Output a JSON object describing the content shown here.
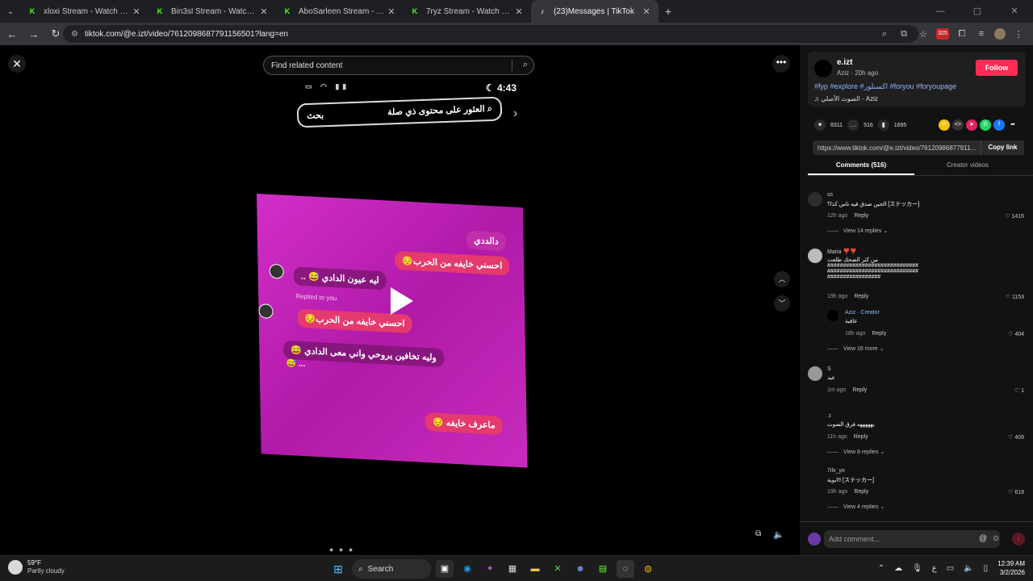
{
  "browser": {
    "tabs": [
      {
        "title": "xloxi Stream - Watch Live on Ki",
        "favicon": "kick-icon",
        "active": false
      },
      {
        "title": "Bin3sl Stream - Watch Live on K",
        "favicon": "kick-icon",
        "active": false
      },
      {
        "title": "AboSarleen Stream - Watch Liv",
        "favicon": "kick-icon",
        "active": false
      },
      {
        "title": "7ryz Stream - Watch Live on Ki",
        "favicon": "kick-icon",
        "active": false
      },
      {
        "title": "(23)Messages | TikTok",
        "favicon": "tiktok-icon",
        "active": true
      }
    ],
    "url": "tiktok.com/@e.izt/video/7612098687791156501?lang=en",
    "extension_badge": "325"
  },
  "video": {
    "find_placeholder": "Find related content",
    "status_time": "4:43",
    "ar_search_text": "العثور على محتوى ذي صلة",
    "ar_search_button": "بحث",
    "chat": {
      "name": "دالددي",
      "msg1": "احسني خايفه من الحرب😔",
      "msg2": "ليه عيون الدادي 😅 ..",
      "replied_label": "Replied to you",
      "msg3": "احسني خايفه من الحرب😔",
      "msg4": "وليه تخافين يروحي واني معى الدادي 😅",
      "msg4b": "... 😅",
      "msg5": "ماعرف خايفه 😔"
    }
  },
  "panel": {
    "username": "e.izt",
    "meta": "Aziz · 20h ago",
    "follow_label": "Follow",
    "tags": "#fyp #explore #اكسبلور #foryou #foryoupage",
    "sound": "♫ الصوت الأصلي - Aziz",
    "likes": "8311",
    "comments_count": "516",
    "saves": "1695",
    "link": "https://www.tiktok.com/@e.izt/video/76120986877911...",
    "copy_label": "Copy link",
    "tab_comments": "Comments (516)",
    "tab_creator": "Creator videos",
    "comments": [
      {
        "name": "ss",
        "text": "الحين صدق فيه ناس كذا؟ [ステッカー]",
        "time": "12h ago",
        "likes": "1416",
        "view_replies": "View 14 replies"
      },
      {
        "name": "Maria ❣️❣️",
        "text": "من كثر الضحك طلعت\n#############################\n#############################\n#################",
        "time": "19h ago",
        "likes": "1153"
      },
      {
        "name": "Aziz · Creator",
        "text": "عافية",
        "time": "18h ago",
        "likes": "404",
        "view_replies": "View 16 more"
      },
      {
        "name": "S",
        "text": "عيد",
        "time": "1m ago",
        "likes": "1"
      },
      {
        "name": ".ɪ",
        "text": "يهههههه فرق الصوت",
        "time": "11h ago",
        "likes": "409",
        "view_replies": "View 8 replies"
      },
      {
        "name": "7ilx_yo",
        "text": "ابوية!! [ステッカー]",
        "time": "19h ago",
        "likes": "619",
        "view_replies": "View 4 replies"
      }
    ],
    "reply_label": "Reply",
    "add_comment_placeholder": "Add comment..."
  },
  "taskbar": {
    "weather_temp": "59°F",
    "weather_desc": "Partly cloudy",
    "search_label": "Search",
    "lang": "ع",
    "time": "12:39 AM",
    "date": "3/2/2026"
  }
}
